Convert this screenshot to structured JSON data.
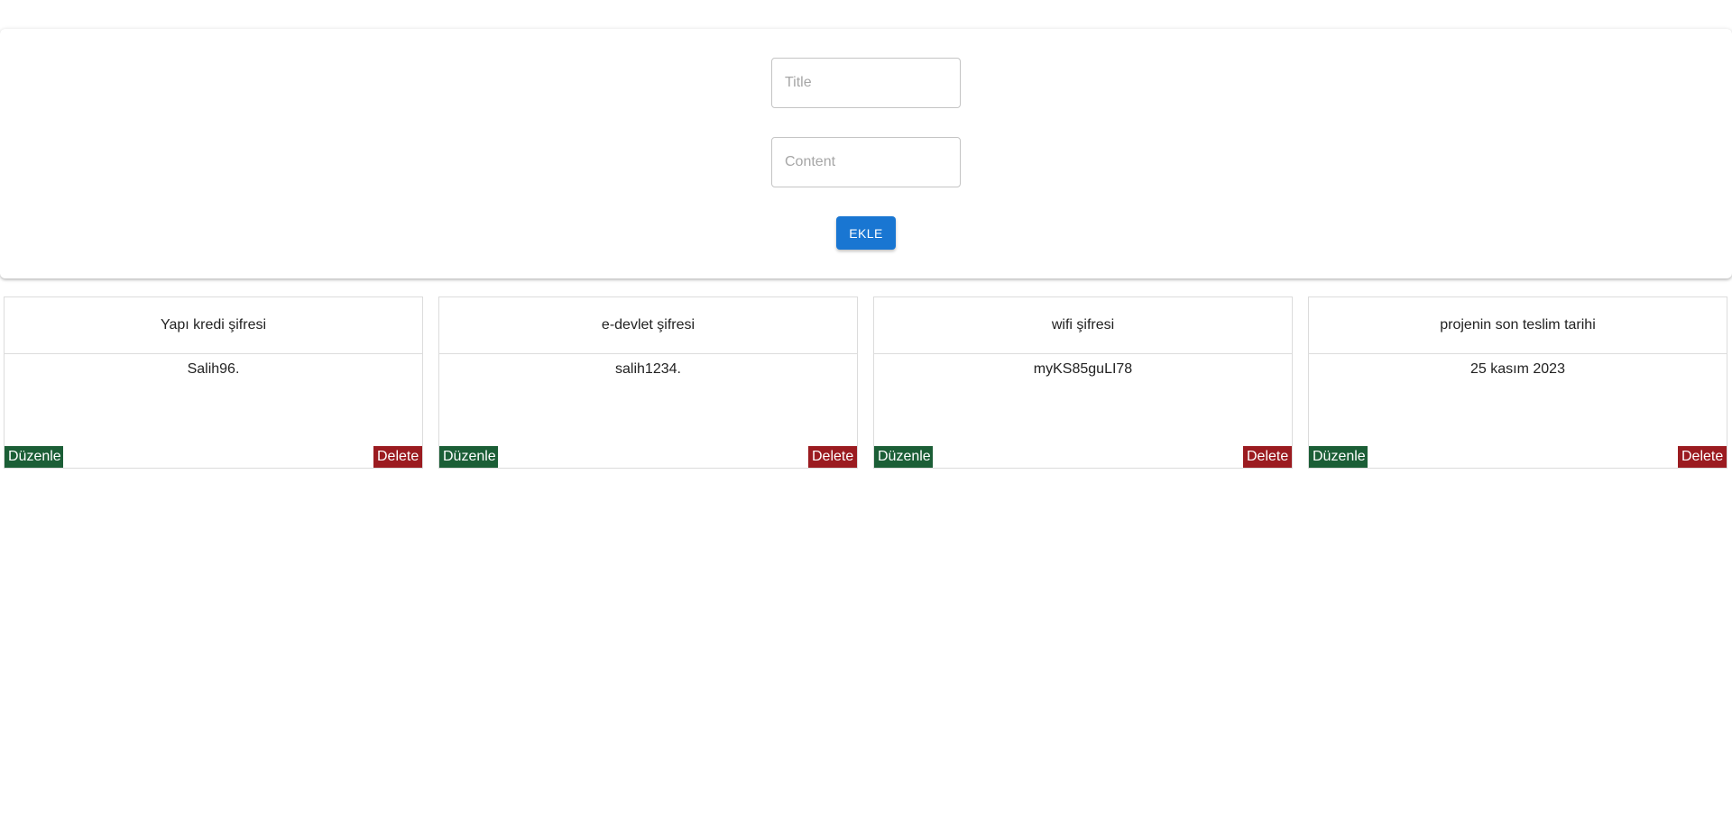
{
  "form": {
    "title_placeholder": "Title",
    "content_placeholder": "Content",
    "add_label": "EKLE"
  },
  "notes": [
    {
      "title": "Yapı kredi şifresi",
      "content": "Salih96.",
      "edit_label": "Düzenle",
      "delete_label": "Delete"
    },
    {
      "title": "e-devlet şifresi",
      "content": "salih1234.",
      "edit_label": "Düzenle",
      "delete_label": "Delete"
    },
    {
      "title": "wifi şifresi",
      "content": "myKS85guLI78",
      "edit_label": "Düzenle",
      "delete_label": "Delete"
    },
    {
      "title": "projenin son teslim tarihi",
      "content": "25 kasım 2023",
      "edit_label": "Düzenle",
      "delete_label": "Delete"
    }
  ],
  "colors": {
    "primary": "#1976d2",
    "edit": "#1b5e36",
    "delete": "#9b1b20"
  }
}
